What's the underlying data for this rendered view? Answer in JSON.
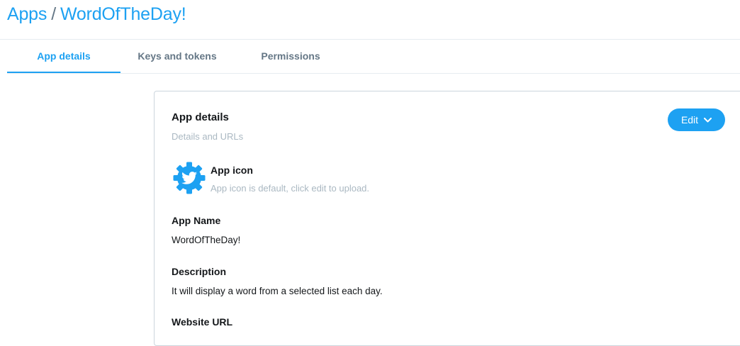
{
  "breadcrumb": {
    "root": "Apps",
    "separator": "/",
    "current": "WordOfTheDay!"
  },
  "tabs": [
    {
      "label": "App details",
      "active": true
    },
    {
      "label": "Keys and tokens",
      "active": false
    },
    {
      "label": "Permissions",
      "active": false
    }
  ],
  "card": {
    "title": "App details",
    "subtitle": "Details and URLs",
    "edit_label": "Edit",
    "app_icon": {
      "icon": "twitter-bird-gear-icon",
      "label": "App icon",
      "help": "App icon is default, click edit to upload."
    },
    "fields": {
      "app_name_label": "App Name",
      "app_name_value": "WordOfTheDay!",
      "description_label": "Description",
      "description_value": "It will display a word from a selected list each day.",
      "website_url_label": "Website URL"
    }
  },
  "colors": {
    "accent": "#1da1f2",
    "muted_text": "#aab8c2",
    "tab_inactive": "#657786",
    "border": "#ccd6dd"
  }
}
